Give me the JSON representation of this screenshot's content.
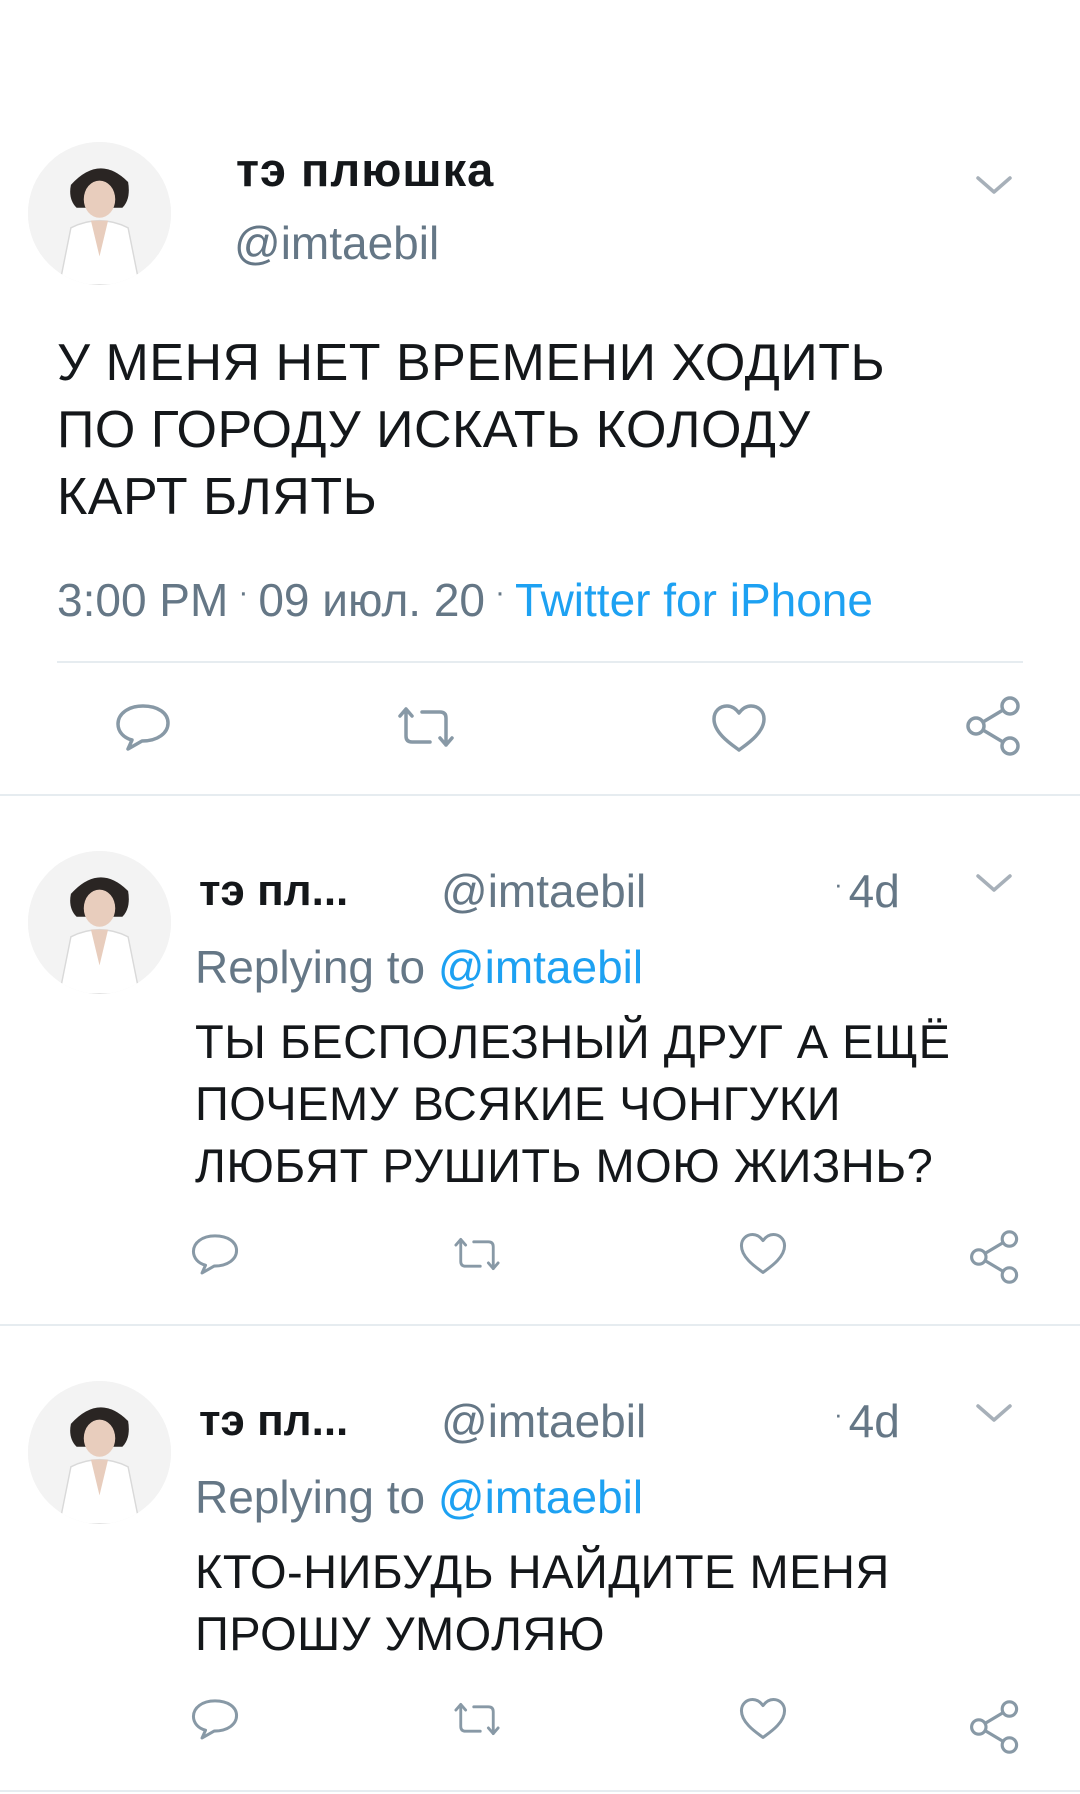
{
  "main_tweet": {
    "display_name": "тэ плюшка",
    "handle": "@imtaebil",
    "text_lines": [
      "У МЕНЯ НЕТ ВРЕМЕНИ ХОДИТЬ",
      "ПО ГОРОДУ ИСКАТЬ КОЛОДУ",
      "КАРТ БЛЯТЬ"
    ],
    "time": "3:00 PM",
    "date": "09 июл. 20",
    "source": "Twitter for iPhone",
    "separator": "·",
    "icons": [
      "chevron-down-icon",
      "reply-icon",
      "retweet-icon",
      "like-icon",
      "share-icon"
    ]
  },
  "replies": [
    {
      "display_name": "тэ пл...",
      "handle": "@imtaebil",
      "time": "4d",
      "replying_prefix": "Replying to",
      "replying_to": "@imtaebil",
      "text_lines": [
        "ТЫ БЕСПОЛЕЗНЫЙ ДРУГ А ЕЩЁ",
        "ПОЧЕМУ ВСЯКИЕ ЧОНГУКИ",
        "ЛЮБЯТ РУШИТЬ МОЮ ЖИЗНЬ?"
      ]
    },
    {
      "display_name": "тэ пл...",
      "handle": "@imtaebil",
      "time": "4d",
      "replying_prefix": "Replying to",
      "replying_to": "@imtaebil",
      "text_lines": [
        "КТО-НИБУДЬ НАЙДИТЕ МЕНЯ",
        "ПРОШУ УМОЛЯЮ"
      ]
    }
  ],
  "colors": {
    "text": "#14171a",
    "secondary": "#657786",
    "link": "#1da1f2",
    "divider": "#e6ecf0"
  }
}
